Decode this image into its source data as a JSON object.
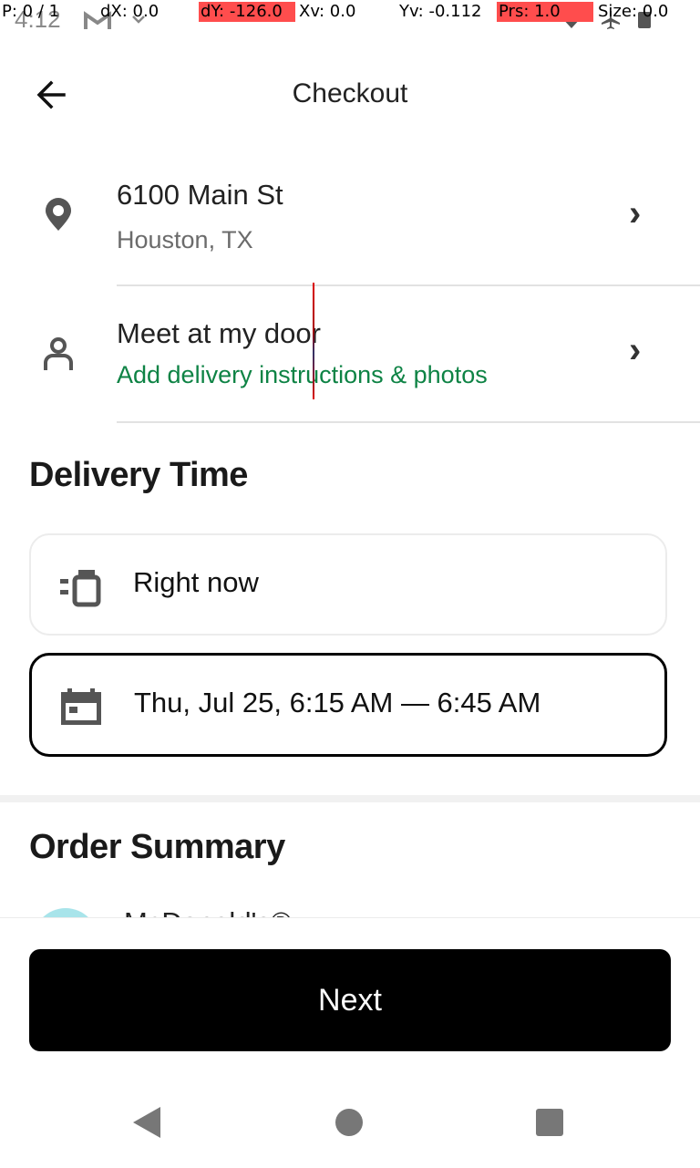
{
  "status_bar": {
    "time": "4:12",
    "pointer_overlay": {
      "p": "P: 0 / 1",
      "dx": "dX: 0.0",
      "dy": "dY: -126.0",
      "xv": "Xv: 0.0",
      "yv": "Yv: -0.112",
      "prs": "Prs: 1.0",
      "size": "Size: 0.0"
    }
  },
  "header": {
    "title": "Checkout"
  },
  "address": {
    "street": "6100 Main St",
    "city": "Houston, TX"
  },
  "dropoff": {
    "title": "Meet at my door",
    "subtitle": "Add delivery instructions & photos"
  },
  "delivery_time": {
    "heading": "Delivery Time",
    "options": [
      {
        "label": "Right now",
        "selected": false,
        "icon": "courier-icon"
      },
      {
        "label": "Thu, Jul 25, 6:15 AM — 6:45 AM",
        "selected": true,
        "icon": "calendar-icon"
      }
    ]
  },
  "order_summary": {
    "heading": "Order Summary",
    "store_peek": "McDonald's®"
  },
  "footer": {
    "next_label": "Next"
  },
  "colors": {
    "accent_green": "#0e8345",
    "primary_button": "#000000",
    "selected_border": "#000000",
    "unselected_border": "#ececec"
  }
}
